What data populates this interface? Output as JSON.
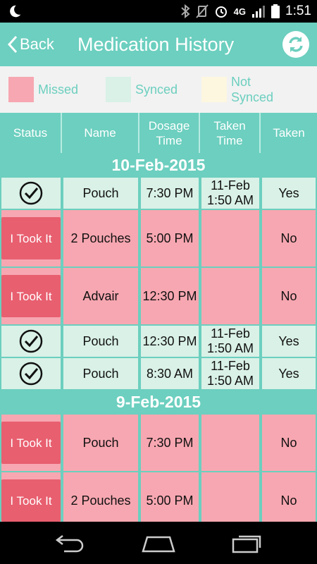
{
  "status_bar": {
    "time": "1:51",
    "network": "4G",
    "icons": [
      "moon-icon",
      "bluetooth-icon",
      "vibrate-off-icon",
      "alarm-icon",
      "signal-icon",
      "battery-icon"
    ]
  },
  "app_bar": {
    "back_label": "Back",
    "title": "Medication History",
    "refresh_icon": "refresh-icon",
    "color": "#6ccfbf"
  },
  "legend": [
    {
      "label": "Missed",
      "color": "#f7a7b1"
    },
    {
      "label": "Synced",
      "color": "#d9f1e7"
    },
    {
      "label": "Not\nSynced",
      "color": "#fdf7e0"
    }
  ],
  "table": {
    "headers": [
      "Status",
      "Name",
      "Dosage\nTime",
      "Taken\nTime",
      "Taken"
    ],
    "took_it_label": "I Took It",
    "groups": [
      {
        "date": "10-Feb-2015",
        "rows": [
          {
            "status": "synced",
            "name": "Pouch",
            "dosage_time": "7:30 PM",
            "taken_time": "11-Feb\n1:50 AM",
            "taken": "Yes"
          },
          {
            "status": "missed",
            "name": "2 Pouches",
            "dosage_time": "5:00 PM",
            "taken_time": "",
            "taken": "No"
          },
          {
            "status": "missed",
            "name": "Advair",
            "dosage_time": "12:30 PM",
            "taken_time": "",
            "taken": "No"
          },
          {
            "status": "synced",
            "name": "Pouch",
            "dosage_time": "12:30 PM",
            "taken_time": "11-Feb\n1:50 AM",
            "taken": "Yes"
          },
          {
            "status": "synced",
            "name": "Pouch",
            "dosage_time": "8:30 AM",
            "taken_time": "11-Feb\n1:50 AM",
            "taken": "Yes"
          }
        ]
      },
      {
        "date": "9-Feb-2015",
        "rows": [
          {
            "status": "missed",
            "name": "Pouch",
            "dosage_time": "7:30 PM",
            "taken_time": "",
            "taken": "No"
          },
          {
            "status": "missed",
            "name": "2 Pouches",
            "dosage_time": "5:00 PM",
            "taken_time": "",
            "taken": "No"
          }
        ]
      }
    ]
  },
  "nav_bar": {
    "buttons": [
      "back-nav-icon",
      "home-nav-icon",
      "recents-nav-icon"
    ]
  }
}
